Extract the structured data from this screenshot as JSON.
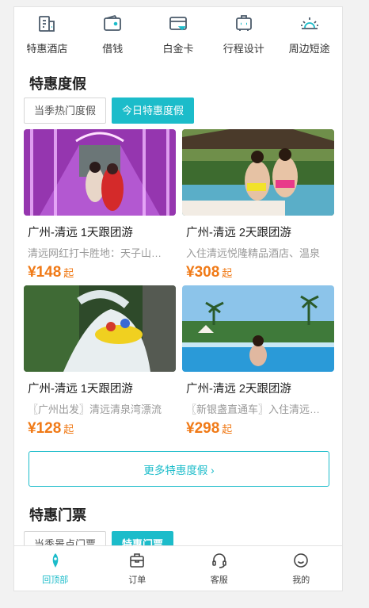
{
  "colors": {
    "accent": "#1cbcca",
    "price": "#f07a17"
  },
  "top_nav": [
    {
      "label": "特惠酒店",
      "icon": "hotel-icon"
    },
    {
      "label": "借钱",
      "icon": "wallet-icon"
    },
    {
      "label": "白金卡",
      "icon": "card-icon"
    },
    {
      "label": "行程设计",
      "icon": "itinerary-icon"
    },
    {
      "label": "周边短途",
      "icon": "sunrise-icon"
    }
  ],
  "vacation": {
    "title": "特惠度假",
    "tabs": [
      {
        "label": "当季热门度假",
        "active": false
      },
      {
        "label": "今日特惠度假",
        "active": true
      }
    ],
    "cards": [
      {
        "title": "广州-清远 1天跟团游",
        "desc": "清远网红打卡胜地：天子山瀑布",
        "price": "¥148",
        "suffix": "起",
        "image": "neon-tunnel-photo"
      },
      {
        "title": "广州-清远 2天跟团游",
        "desc": "入住清远悦隆精品酒店、温泉",
        "price": "¥308",
        "suffix": "起",
        "image": "hot-spring-pool-photo"
      },
      {
        "title": "广州-清远 1天跟团游",
        "desc": "〖广州出发〗清远清泉湾漂流",
        "price": "¥128",
        "suffix": "起",
        "image": "rafting-photo"
      },
      {
        "title": "广州-清远 2天跟团游",
        "desc": "〖新银盏直通车〗入住清远温泉",
        "price": "¥298",
        "suffix": "起",
        "image": "resort-pool-photo"
      }
    ],
    "more_label": "更多特惠度假 ›"
  },
  "tickets": {
    "title": "特惠门票",
    "tabs": [
      {
        "label": "当季景点门票",
        "active": false
      },
      {
        "label": "特惠门票",
        "active": true
      }
    ]
  },
  "bottom_nav": [
    {
      "label": "回顶部",
      "icon": "rocket-icon",
      "active": true
    },
    {
      "label": "订单",
      "icon": "order-icon",
      "active": false
    },
    {
      "label": "客服",
      "icon": "headset-icon",
      "active": false
    },
    {
      "label": "我的",
      "icon": "smile-icon",
      "active": false
    }
  ]
}
